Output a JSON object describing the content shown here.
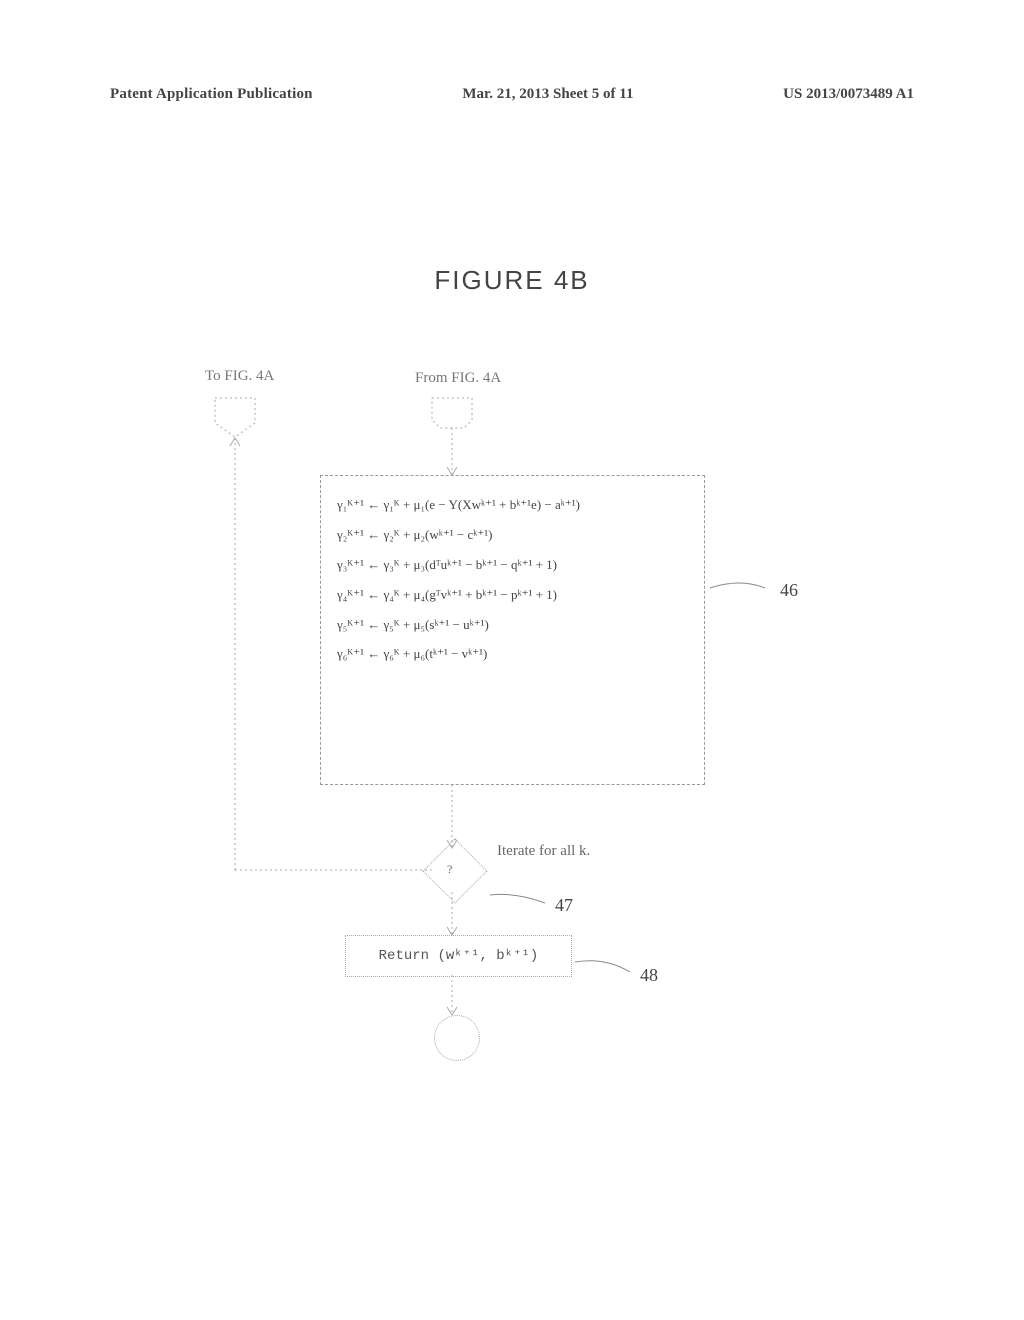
{
  "header": {
    "left": "Patent Application Publication",
    "center": "Mar. 21, 2013  Sheet 5 of 11",
    "right": "US 2013/0073489 A1"
  },
  "figure_title": "FIGURE 4B",
  "connectors": {
    "to": "To FIG. 4A",
    "from": "From FIG. 4A"
  },
  "box46": {
    "lines": [
      "γ₁ᴷ⁺¹ ← γ₁ᴷ + μ₁(e − Y(Xwᵏ⁺¹ + bᵏ⁺¹e) − aᵏ⁺¹)",
      "γ₂ᴷ⁺¹ ← γ₂ᴷ + μ₂(wᵏ⁺¹ − cᵏ⁺¹)",
      "γ₃ᴷ⁺¹ ← γ₃ᴷ + μ₃(dᵀuᵏ⁺¹ − bᵏ⁺¹ − qᵏ⁺¹ + 1)",
      "γ₄ᴷ⁺¹ ← γ₄ᴷ + μ₄(gᵀvᵏ⁺¹ + bᵏ⁺¹ − pᵏ⁺¹ + 1)",
      "γ₅ᴷ⁺¹ ← γ₅ᴷ + μ₅(sᵏ⁺¹ − uᵏ⁺¹)",
      "γ₆ᴷ⁺¹ ← γ₆ᴷ + μ₆(tᵏ⁺¹ − vᵏ⁺¹)"
    ]
  },
  "diamond": {
    "mark": "?"
  },
  "iterate_label": "Iterate for all k.",
  "box48": {
    "text": "Return (wᵏ⁺¹, bᵏ⁺¹)"
  },
  "refs": {
    "r46": "46",
    "r47": "47",
    "r48": "48"
  }
}
